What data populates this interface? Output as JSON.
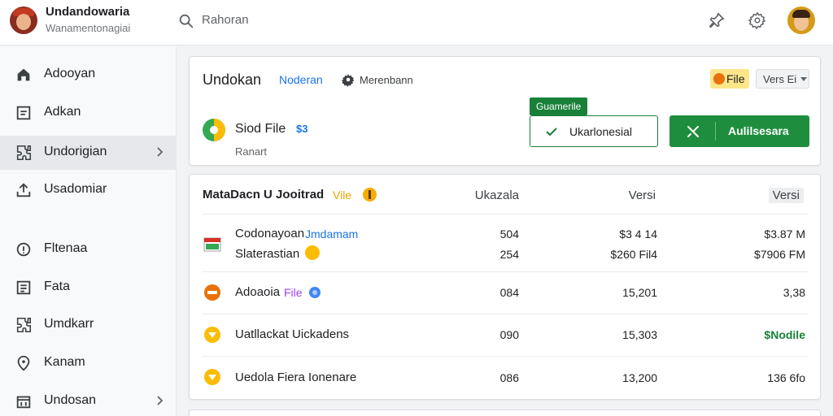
{
  "header": {
    "title": "Undandowaria",
    "subtitle": "Wanamentonagiai",
    "search_placeholder": "Rahoran"
  },
  "sidebar": {
    "items": [
      {
        "label": "Adooyan",
        "icon": "home-icon"
      },
      {
        "label": "Adkan",
        "icon": "document-icon"
      },
      {
        "label": "Undorigian",
        "icon": "puzzle-icon",
        "active": true
      },
      {
        "label": "Usadomiar",
        "icon": "upload-icon"
      },
      {
        "label": "Fltenaa",
        "icon": "info-icon"
      },
      {
        "label": "Fata",
        "icon": "list-icon"
      },
      {
        "label": "Umdkarr",
        "icon": "puzzle-icon"
      },
      {
        "label": "Kanam",
        "icon": "location-icon"
      },
      {
        "label": "Undosan",
        "icon": "calendar-icon"
      }
    ]
  },
  "card": {
    "title": "Undokan",
    "link": "Noderan",
    "settings_label": "Merenbann",
    "file_chip": "File",
    "select_value": "Vers Ei",
    "file_name": "Siod File",
    "file_badge": "$3",
    "file_sub": "Ranart",
    "tooltip": "Guamerile",
    "secondary_button": "Ukarlonesial",
    "primary_button": "Aulilsesara"
  },
  "table": {
    "title": "MataDacn U Jooitrad",
    "title_accent": "Vile",
    "columns": [
      "Ukazala",
      "Versi",
      "Versi"
    ],
    "rows": [
      {
        "name": "Codonayoan",
        "tag": "Jmdamam",
        "name2": "Slaterastian",
        "v1": "504",
        "v1b": "254",
        "v2": "$3 4 14",
        "v2b": "$260 Fil4",
        "v3": "$3.87 M",
        "v3b": "$7906 FM"
      },
      {
        "name": "Adoaoia",
        "tag": "File",
        "v1": "084",
        "v2": "15,201",
        "v3": "3,38"
      },
      {
        "name": "Uatllackat Uickadens",
        "tag": "",
        "v1": "090",
        "v2": "15,303",
        "v3": "$Nodile"
      },
      {
        "name": "Uedola Fiera Ionenare",
        "tag": "",
        "v1": "086",
        "v2": "13,200",
        "v3": "136 6fo"
      }
    ]
  },
  "colors": {
    "accent_green": "#1e8e3e",
    "link_blue": "#1a73e8",
    "warning_yellow": "#f9ab00",
    "danger_orange": "#e8710a"
  }
}
